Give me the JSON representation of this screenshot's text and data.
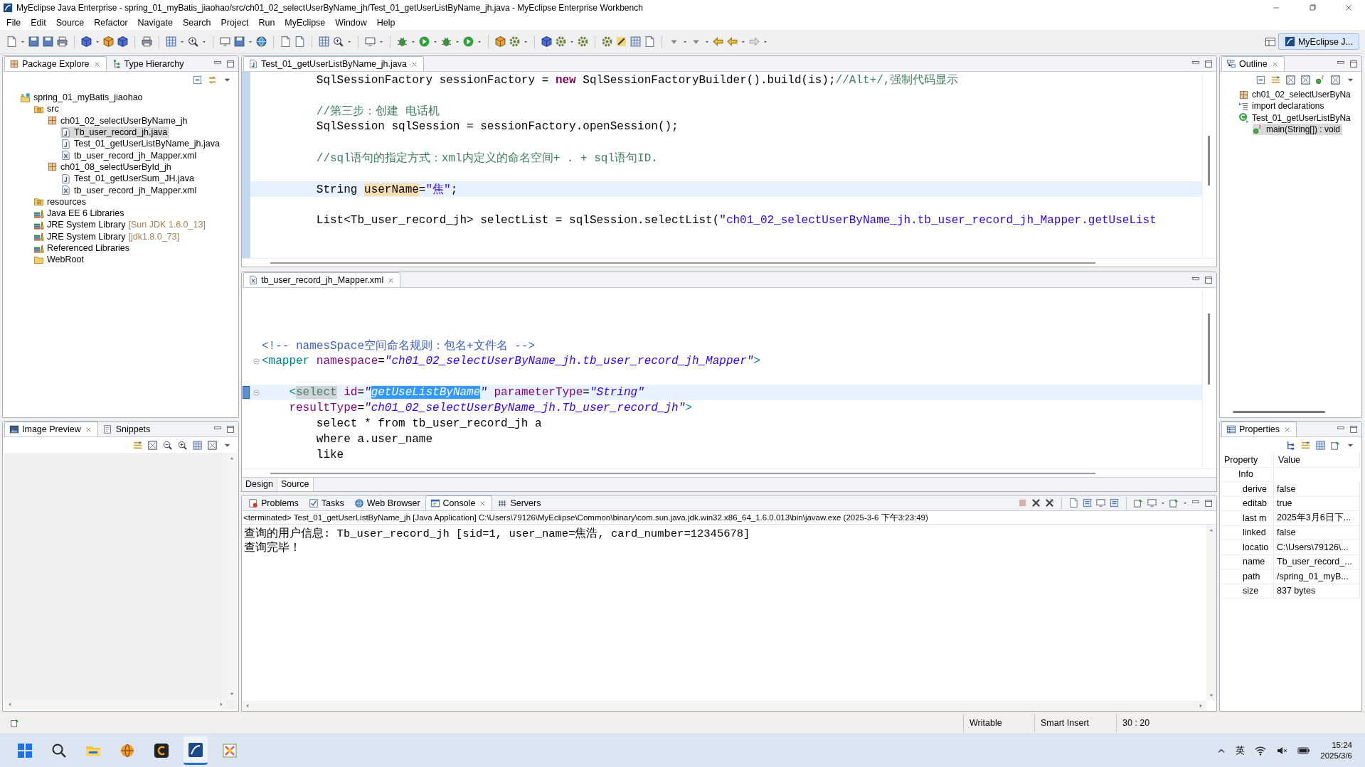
{
  "window": {
    "title": "MyEclipse Java Enterprise - spring_01_myBatis_jiaohao/src/ch01_02_selectUserByName_jh/Test_01_getUserListByName_jh.java - MyEclipse Enterprise Workbench"
  },
  "menu": [
    "File",
    "Edit",
    "Source",
    "Refactor",
    "Navigate",
    "Search",
    "Project",
    "Run",
    "MyEclipse",
    "Window",
    "Help"
  ],
  "perspective": {
    "label": "MyEclipse J...",
    "selected": true
  },
  "package_explorer": {
    "tabs": [
      {
        "label": "Package Explore",
        "kind": "package",
        "selected": true
      },
      {
        "label": "Type Hierarchy",
        "kind": "hierarchy",
        "selected": false
      }
    ],
    "tree": [
      {
        "label": "spring_01_myBatis_jiaohao",
        "kind": "project",
        "selected": false,
        "children": [
          {
            "label": "src",
            "kind": "srcfolder",
            "selected": false,
            "children": [
              {
                "label": "ch01_02_selectUserByName_jh",
                "kind": "package",
                "selected": false,
                "children": [
                  {
                    "label": "Tb_user_record_jh.java",
                    "kind": "java",
                    "selected": true
                  },
                  {
                    "label": "Test_01_getUserListByName_jh.java",
                    "kind": "java",
                    "selected": false
                  },
                  {
                    "label": "tb_user_record_jh_Mapper.xml",
                    "kind": "xml",
                    "selected": false
                  }
                ]
              },
              {
                "label": "ch01_08_selectUserById_jh",
                "kind": "package",
                "selected": false,
                "children": [
                  {
                    "label": "Test_01_getUserSum_JH.java",
                    "kind": "java",
                    "selected": false
                  },
                  {
                    "label": "tb_user_record_jh_Mapper.xml",
                    "kind": "xml",
                    "selected": false
                  }
                ]
              }
            ]
          },
          {
            "label": "resources",
            "kind": "srcfolder",
            "selected": false
          },
          {
            "label": "Java EE 6 Libraries",
            "kind": "library",
            "selected": false
          },
          {
            "label": "JRE System Library",
            "decoration": "[Sun JDK 1.6.0_13]",
            "kind": "library",
            "selected": false
          },
          {
            "label": "JRE System Library",
            "decoration": "[jdk1.8.0_73]",
            "kind": "library",
            "selected": false
          },
          {
            "label": "Referenced Libraries",
            "kind": "library",
            "selected": false
          },
          {
            "label": "WebRoot",
            "kind": "folder",
            "selected": false
          }
        ]
      }
    ]
  },
  "image_preview": {
    "tabs": [
      {
        "label": "Image Preview",
        "kind": "image",
        "selected": true
      },
      {
        "label": "Snippets",
        "kind": "snippet",
        "selected": false
      }
    ]
  },
  "java_editor": {
    "tabs": [
      {
        "label": "Test_01_getUserListByName_jh.java",
        "kind": "java",
        "selected": true
      }
    ],
    "lines": [
      {
        "current": false,
        "segments": [
          {
            "kind": "plain",
            "text": "        SqlSessionFactory sessionFactory = "
          },
          {
            "kind": "keyword",
            "text": "new"
          },
          {
            "kind": "plain",
            "text": " SqlSessionFactoryBuilder().build(is);"
          },
          {
            "kind": "comment",
            "text": "//Alt+/,强制代码显示"
          }
        ]
      },
      {
        "current": false
      },
      {
        "current": false,
        "segments": [
          {
            "kind": "comment",
            "text": "        //第三步：创建 电话机"
          }
        ]
      },
      {
        "current": false,
        "segments": [
          {
            "kind": "plain",
            "text": "        SqlSession sqlSession = sessionFactory.openSession();"
          }
        ]
      },
      {
        "current": false
      },
      {
        "current": false,
        "segments": [
          {
            "kind": "comment",
            "text": "        //sql语句的指定方式：xml内定义的命名空间+ . + sql语句ID."
          }
        ]
      },
      {
        "current": false
      },
      {
        "current": true,
        "segments": [
          {
            "kind": "plain",
            "text": "        String "
          },
          {
            "kind": "occurrence",
            "text": "userName"
          },
          {
            "kind": "plain",
            "text": "="
          },
          {
            "kind": "string",
            "text": "\"焦\""
          },
          {
            "kind": "plain",
            "text": ";"
          }
        ]
      },
      {
        "current": false
      },
      {
        "current": false,
        "segments": [
          {
            "kind": "plain",
            "text": "        List<Tb_user_record_jh> selectList = sqlSession.selectList("
          },
          {
            "kind": "string",
            "text": "\"ch01_02_selectUserByName_jh.tb_user_record_jh_Mapper.getUseList"
          }
        ]
      },
      {
        "current": false
      }
    ]
  },
  "xml_editor": {
    "tabs": [
      {
        "label": "tb_user_record_jh_Mapper.xml",
        "kind": "xml",
        "selected": true
      }
    ],
    "lines": [
      {
        "current": false,
        "marked": false,
        "fold": false
      },
      {
        "current": false,
        "marked": false,
        "fold": false
      },
      {
        "current": false,
        "marked": false,
        "fold": false
      },
      {
        "current": false,
        "marked": false,
        "fold": false,
        "segments": [
          {
            "kind": "comment",
            "text": "<!-- namesSpace空间命名规则：包名+文件名 -->"
          }
        ]
      },
      {
        "current": false,
        "marked": false,
        "fold": true,
        "segments": [
          {
            "kind": "tag",
            "text": "<mapper"
          },
          {
            "kind": "attr",
            "text": " namespace"
          },
          {
            "kind": "plain",
            "text": "="
          },
          {
            "kind": "value",
            "text": "\"ch01_02_selectUserByName_jh.tb_user_record_jh_Mapper\""
          },
          {
            "kind": "tag",
            "text": ">"
          }
        ]
      },
      {
        "current": false,
        "marked": false,
        "fold": false
      },
      {
        "current": true,
        "marked": true,
        "fold": true,
        "segments": [
          {
            "kind": "tag",
            "text": "    <"
          },
          {
            "kind": "matched",
            "text": "select"
          },
          {
            "kind": "attr",
            "text": " id"
          },
          {
            "kind": "plain",
            "text": "="
          },
          {
            "kind": "value",
            "text": "\""
          },
          {
            "kind": "selection",
            "text": "getUseListByName"
          },
          {
            "kind": "value",
            "text": "\""
          },
          {
            "kind": "attr",
            "text": " parameterType"
          },
          {
            "kind": "plain",
            "text": "="
          },
          {
            "kind": "value",
            "text": "\"String\""
          }
        ]
      },
      {
        "current": false,
        "marked": false,
        "fold": false,
        "segments": [
          {
            "kind": "attr",
            "text": "    resultType"
          },
          {
            "kind": "plain",
            "text": "="
          },
          {
            "kind": "value",
            "text": "\"ch01_02_selectUserByName_jh.Tb_user_record_jh\""
          },
          {
            "kind": "tag",
            "text": ">"
          }
        ]
      },
      {
        "current": false,
        "marked": false,
        "fold": false,
        "segments": [
          {
            "kind": "plain",
            "text": "        select * from tb_user_record_jh a"
          }
        ]
      },
      {
        "current": false,
        "marked": false,
        "fold": false,
        "segments": [
          {
            "kind": "plain",
            "text": "        where a.user_name"
          }
        ]
      },
      {
        "current": false,
        "marked": false,
        "fold": false,
        "segments": [
          {
            "kind": "plain",
            "text": "        like"
          }
        ]
      }
    ],
    "bottom_tabs": [
      {
        "label": "Design",
        "selected": false
      },
      {
        "label": "Source",
        "selected": true
      }
    ]
  },
  "console": {
    "tabs": [
      {
        "label": "Problems",
        "kind": "problems",
        "selected": false
      },
      {
        "label": "Tasks",
        "kind": "tasks",
        "selected": false
      },
      {
        "label": "Web Browser",
        "kind": "globe",
        "selected": false
      },
      {
        "label": "Console",
        "kind": "console",
        "selected": true
      },
      {
        "label": "Servers",
        "kind": "servers",
        "selected": false
      }
    ],
    "process": "<terminated> Test_01_getUserListByName_jh [Java Application] C:\\Users\\79126\\MyEclipse\\Common\\binary\\com.sun.java.jdk.win32.x86_64_1.6.0.013\\bin\\javaw.exe (2025-3-6 下午3:23:49)",
    "output": [
      "查询的用户信息: Tb_user_record_jh [sid=1, user_name=焦浩, card_number=12345678]",
      "查询完毕！"
    ]
  },
  "outline": {
    "tabs": [
      {
        "label": "Outline",
        "kind": "outline",
        "selected": true
      }
    ],
    "tree": [
      {
        "label": "ch01_02_selectUserByNa",
        "kind": "package",
        "selected": false
      },
      {
        "label": "import declarations",
        "kind": "imports",
        "selected": false
      },
      {
        "label": "Test_01_getUserListByNa",
        "kind": "class",
        "selected": false,
        "children": [
          {
            "label": "main(String[]) : void",
            "kind": "method",
            "selected": true
          }
        ]
      }
    ]
  },
  "properties": {
    "tabs": [
      {
        "label": "Properties",
        "kind": "properties",
        "selected": true
      }
    ],
    "columns": [
      "Property",
      "Value"
    ],
    "category": "Info",
    "rows": [
      {
        "property": "derive",
        "value": "false"
      },
      {
        "property": "editab",
        "value": "true"
      },
      {
        "property": "last m",
        "value": "2025年3月6日下..."
      },
      {
        "property": "linked",
        "value": "false"
      },
      {
        "property": "locatio",
        "value": "C:\\Users\\79126\\..."
      },
      {
        "property": "name",
        "value": "Tb_user_record_..."
      },
      {
        "property": "path",
        "value": "/spring_01_myB..."
      },
      {
        "property": "size",
        "value": "837  bytes"
      }
    ]
  },
  "status_bar": [
    "Writable",
    "Smart Insert",
    "30 : 20"
  ],
  "taskbar": {
    "ime": "英",
    "time": "15:24",
    "date": "2025/3/6"
  }
}
